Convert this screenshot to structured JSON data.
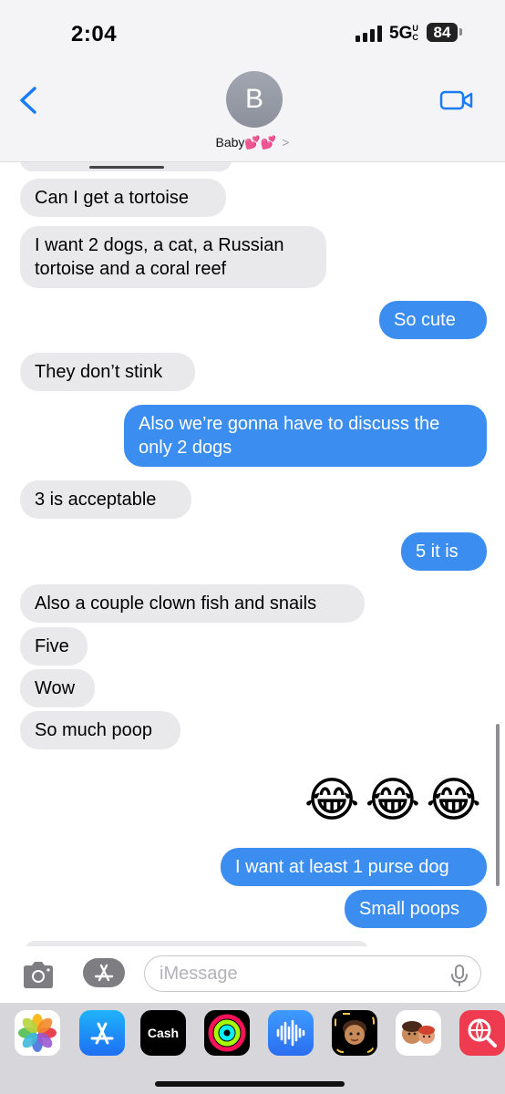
{
  "status_bar": {
    "time": "2:04",
    "network": "5G",
    "network_sub": "UC",
    "battery": "84"
  },
  "header": {
    "avatar_initial": "B",
    "contact_name": "Baby💕💕",
    "chevron": ">"
  },
  "messages": [
    {
      "dir": "in",
      "lines": [
        "Can I get a tortoise"
      ]
    },
    {
      "dir": "in",
      "lines": [
        "I want 2 dogs, a cat, a Russian",
        "tortoise and a coral reef"
      ]
    },
    {
      "dir": "out",
      "lines": [
        "So cute"
      ]
    },
    {
      "dir": "in",
      "lines": [
        "They don’t stink"
      ]
    },
    {
      "dir": "out",
      "lines": [
        "Also we’re gonna have to discuss the",
        "only 2 dogs"
      ]
    },
    {
      "dir": "in",
      "lines": [
        "3 is acceptable"
      ]
    },
    {
      "dir": "out",
      "lines": [
        "5 it is"
      ]
    },
    {
      "dir": "in",
      "lines": [
        "Also a couple clown fish and snails"
      ]
    },
    {
      "dir": "in",
      "lines": [
        "Five"
      ]
    },
    {
      "dir": "in",
      "lines": [
        "Wow"
      ]
    },
    {
      "dir": "in",
      "lines": [
        "So much poop"
      ]
    },
    {
      "dir": "out",
      "emoji": "😂😂😂"
    },
    {
      "dir": "out",
      "lines": [
        "I want at least 1 purse dog"
      ]
    },
    {
      "dir": "out",
      "lines": [
        "Small poops"
      ]
    }
  ],
  "input": {
    "placeholder": "iMessage"
  },
  "apps": [
    {
      "name": "photos-app",
      "label": ""
    },
    {
      "name": "app-store-app",
      "label": ""
    },
    {
      "name": "apple-cash-app",
      "label": "Cash"
    },
    {
      "name": "fitness-activity-app",
      "label": ""
    },
    {
      "name": "audio-message-app",
      "label": ""
    },
    {
      "name": "memoji-app",
      "label": ""
    },
    {
      "name": "memoji-stickers-app",
      "label": ""
    },
    {
      "name": "web-search-app",
      "label": ""
    }
  ],
  "colors": {
    "outgoing": "#3b8ef0",
    "incoming": "#e9e9eb",
    "accent": "#1a7cf5"
  }
}
